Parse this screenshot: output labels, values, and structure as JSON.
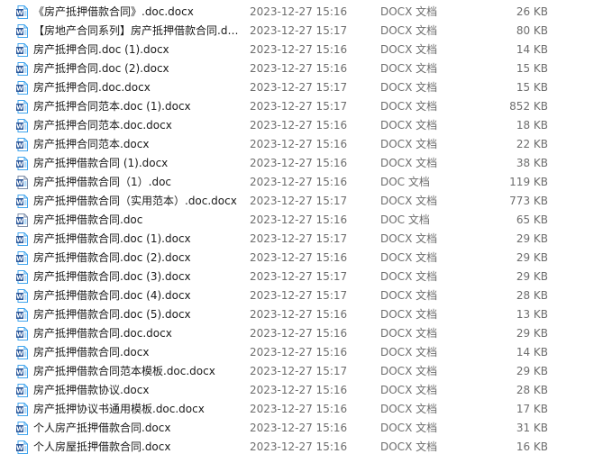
{
  "colors": {
    "word_icon_blue": "#2b579a",
    "word_icon_light": "#41a5ee"
  },
  "files": [
    {
      "name": "《房产抵押借款合同》.doc.docx",
      "date": "2023-12-27 15:16",
      "type": "DOCX 文档",
      "size": "26 KB",
      "icon": "word-document-icon"
    },
    {
      "name": "【房地产合同系列】房产抵押借款合同.doc.docx",
      "date": "2023-12-27 15:17",
      "type": "DOCX 文档",
      "size": "80 KB",
      "icon": "word-document-icon"
    },
    {
      "name": "房产抵押合同.doc (1).docx",
      "date": "2023-12-27 15:16",
      "type": "DOCX 文档",
      "size": "14 KB",
      "icon": "word-document-icon"
    },
    {
      "name": "房产抵押合同.doc (2).docx",
      "date": "2023-12-27 15:16",
      "type": "DOCX 文档",
      "size": "15 KB",
      "icon": "word-document-icon"
    },
    {
      "name": "房产抵押合同.doc.docx",
      "date": "2023-12-27 15:17",
      "type": "DOCX 文档",
      "size": "15 KB",
      "icon": "word-document-icon"
    },
    {
      "name": "房产抵押合同范本.doc (1).docx",
      "date": "2023-12-27 15:17",
      "type": "DOCX 文档",
      "size": "852 KB",
      "icon": "word-document-icon"
    },
    {
      "name": "房产抵押合同范本.doc.docx",
      "date": "2023-12-27 15:16",
      "type": "DOCX 文档",
      "size": "18 KB",
      "icon": "word-document-icon"
    },
    {
      "name": "房产抵押合同范本.docx",
      "date": "2023-12-27 15:16",
      "type": "DOCX 文档",
      "size": "22 KB",
      "icon": "word-document-icon"
    },
    {
      "name": "房产抵押借款合同 (1).docx",
      "date": "2023-12-27 15:16",
      "type": "DOCX 文档",
      "size": "38 KB",
      "icon": "word-document-icon"
    },
    {
      "name": "房产抵押借款合同（1）.doc",
      "date": "2023-12-27 15:16",
      "type": "DOC 文档",
      "size": "119 KB",
      "icon": "word-legacy-document-icon"
    },
    {
      "name": "房产抵押借款合同（实用范本）.doc.docx",
      "date": "2023-12-27 15:17",
      "type": "DOCX 文档",
      "size": "773 KB",
      "icon": "word-document-icon"
    },
    {
      "name": "房产抵押借款合同.doc",
      "date": "2023-12-27 15:16",
      "type": "DOC 文档",
      "size": "65 KB",
      "icon": "word-legacy-document-icon"
    },
    {
      "name": "房产抵押借款合同.doc (1).docx",
      "date": "2023-12-27 15:17",
      "type": "DOCX 文档",
      "size": "29 KB",
      "icon": "word-document-icon"
    },
    {
      "name": "房产抵押借款合同.doc (2).docx",
      "date": "2023-12-27 15:16",
      "type": "DOCX 文档",
      "size": "29 KB",
      "icon": "word-document-icon"
    },
    {
      "name": "房产抵押借款合同.doc (3).docx",
      "date": "2023-12-27 15:17",
      "type": "DOCX 文档",
      "size": "29 KB",
      "icon": "word-document-icon"
    },
    {
      "name": "房产抵押借款合同.doc (4).docx",
      "date": "2023-12-27 15:17",
      "type": "DOCX 文档",
      "size": "28 KB",
      "icon": "word-document-icon"
    },
    {
      "name": "房产抵押借款合同.doc (5).docx",
      "date": "2023-12-27 15:16",
      "type": "DOCX 文档",
      "size": "13 KB",
      "icon": "word-document-icon"
    },
    {
      "name": "房产抵押借款合同.doc.docx",
      "date": "2023-12-27 15:16",
      "type": "DOCX 文档",
      "size": "29 KB",
      "icon": "word-document-icon"
    },
    {
      "name": "房产抵押借款合同.docx",
      "date": "2023-12-27 15:16",
      "type": "DOCX 文档",
      "size": "14 KB",
      "icon": "word-document-icon"
    },
    {
      "name": "房产抵押借款合同范本模板.doc.docx",
      "date": "2023-12-27 15:17",
      "type": "DOCX 文档",
      "size": "29 KB",
      "icon": "word-document-icon"
    },
    {
      "name": "房产抵押借款协议.docx",
      "date": "2023-12-27 15:16",
      "type": "DOCX 文档",
      "size": "28 KB",
      "icon": "word-document-icon"
    },
    {
      "name": "房产抵押协议书通用模板.doc.docx",
      "date": "2023-12-27 15:16",
      "type": "DOCX 文档",
      "size": "17 KB",
      "icon": "word-document-icon"
    },
    {
      "name": "个人房产抵押借款合同.docx",
      "date": "2023-12-27 15:16",
      "type": "DOCX 文档",
      "size": "31 KB",
      "icon": "word-document-icon"
    },
    {
      "name": "个人房屋抵押借款合同.docx",
      "date": "2023-12-27 15:16",
      "type": "DOCX 文档",
      "size": "16 KB",
      "icon": "word-document-icon"
    }
  ]
}
